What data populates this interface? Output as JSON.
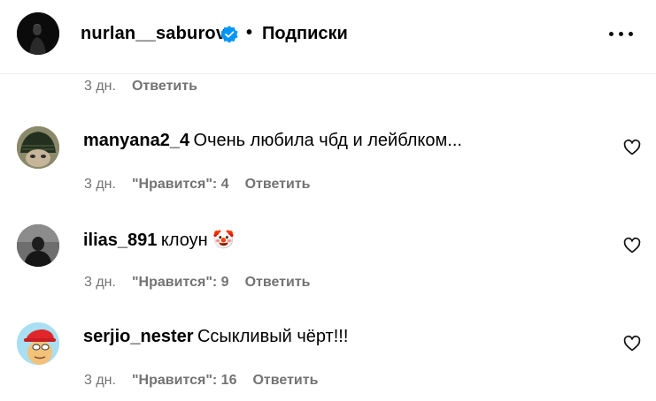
{
  "header": {
    "username": "nurlan__saburov",
    "separator": "•",
    "follow_label": "Подписки"
  },
  "top_meta": {
    "time": "3 дн.",
    "reply_label": "Ответить"
  },
  "comments": [
    {
      "username": "manyana2_4",
      "text": "Очень любила чбд и лейблком...",
      "time": "3 дн.",
      "likes_label": "\"Нравится\": 4",
      "reply_label": "Ответить"
    },
    {
      "username": "ilias_891",
      "text": "клоун 🤡",
      "time": "3 дн.",
      "likes_label": "\"Нравится\": 9",
      "reply_label": "Ответить"
    },
    {
      "username": "serjio_nester",
      "text": "Ссыкливый чёрт!!!",
      "time": "3 дн.",
      "likes_label": "\"Нравится\": 16",
      "reply_label": "Ответить"
    }
  ],
  "colors": {
    "verified": "#0095f6",
    "meta_text": "#737373",
    "divider": "#efefef"
  },
  "icons": {
    "verified": "verified-badge-icon",
    "more": "more-options-icon",
    "like": "heart-icon"
  }
}
